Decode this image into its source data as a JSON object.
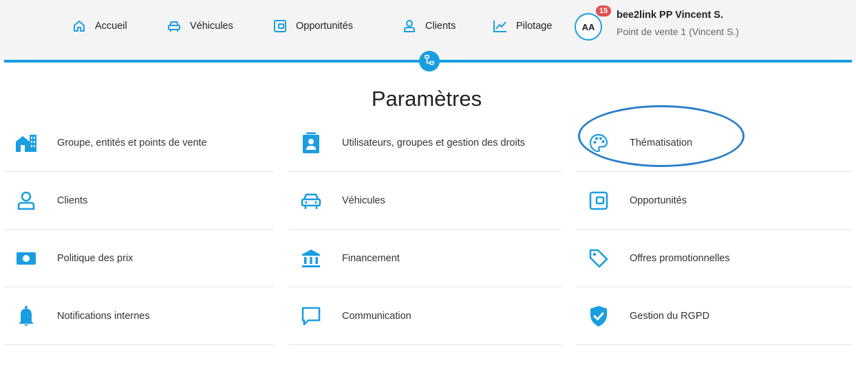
{
  "nav": {
    "items": [
      {
        "label": "Accueil",
        "icon": "home-icon"
      },
      {
        "label": "Véhicules",
        "icon": "car-icon"
      },
      {
        "label": "Opportunités",
        "icon": "wallet-icon"
      },
      {
        "label": "Clients",
        "icon": "user-icon"
      },
      {
        "label": "Pilotage",
        "icon": "chart-line-icon"
      }
    ]
  },
  "user": {
    "initials": "AA",
    "notifications": "15",
    "name": "bee2link PP Vincent S.",
    "point_of_sale": "Point de vente 1 (Vincent S.)"
  },
  "page": {
    "title": "Paramètres"
  },
  "settings": {
    "items": [
      {
        "label": "Groupe, entités et points de vente",
        "icon": "building-icon"
      },
      {
        "label": "Utilisateurs, groupes et gestion des droits",
        "icon": "id-badge-icon"
      },
      {
        "label": "Thématisation",
        "icon": "palette-icon"
      },
      {
        "label": "Clients",
        "icon": "user-icon"
      },
      {
        "label": "Véhicules",
        "icon": "car-icon"
      },
      {
        "label": "Opportunités",
        "icon": "wallet-icon"
      },
      {
        "label": "Politique des prix",
        "icon": "banknote-icon"
      },
      {
        "label": "Financement",
        "icon": "bank-icon"
      },
      {
        "label": "Offres promotionnelles",
        "icon": "tag-icon"
      },
      {
        "label": "Notifications internes",
        "icon": "bell-icon"
      },
      {
        "label": "Communication",
        "icon": "chat-bubble-icon"
      },
      {
        "label": "Gestion du RGPD",
        "icon": "shield-check-icon"
      }
    ]
  },
  "colors": {
    "accent": "#1a9ee0",
    "badge": "#e05050",
    "highlight": "#2a7fc8",
    "topbar_bg": "#f4f4f4"
  }
}
